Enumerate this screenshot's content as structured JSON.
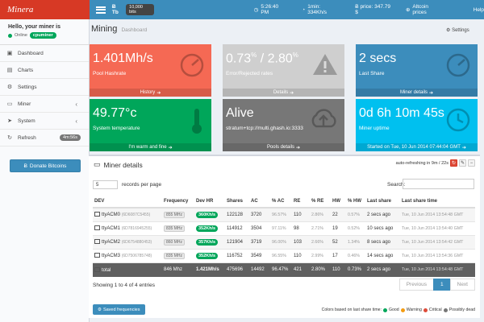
{
  "header": {
    "logo": "Minera",
    "btc_label": "Ƀ Tb",
    "bits_badge": "10,000 bits",
    "time": "5:26:40 PM",
    "hashrate_top": "1min: 334Kh/s",
    "price": "Ƀ price: 347.79 $",
    "altcoin": "Altcoin prices",
    "help": "Help",
    "help_count": "1"
  },
  "user": {
    "hello": "Hello, your miner is",
    "status": "Online",
    "name": "cpuminer"
  },
  "menu": [
    {
      "label": "Dashboard",
      "icon": "dashboard-icon",
      "glyph": "▣",
      "chevron": ""
    },
    {
      "label": "Charts",
      "icon": "charts-icon",
      "glyph": "▤",
      "chevron": ""
    },
    {
      "label": "Settings",
      "icon": "settings-icon",
      "glyph": "⚙",
      "chevron": ""
    },
    {
      "label": "Miner",
      "icon": "desktop-icon",
      "glyph": "▭",
      "chevron": "‹"
    },
    {
      "label": "System",
      "icon": "rocket-icon",
      "glyph": "➤",
      "chevron": "‹"
    },
    {
      "label": "Refresh",
      "icon": "refresh-icon",
      "glyph": "↻",
      "chevron": ""
    }
  ],
  "refresh_badge": "4m:56s",
  "donate": "Donate Bitcoins",
  "page": {
    "title": "Mining",
    "subtitle": "Dashboard",
    "settings": "Settings"
  },
  "boxes": [
    {
      "value": "1.401Mh/s",
      "label": "Pool Hashrate",
      "footer": "History",
      "color": "#f56954",
      "icon": "gauge-icon"
    },
    {
      "value_a": "0.73",
      "sup_a": "%",
      "sep": " / ",
      "value_b": "2.80",
      "sup_b": "%",
      "label": "Error/Rejected rates",
      "footer": "Details",
      "color": "#cfcfcf",
      "icon": "warning-icon"
    },
    {
      "value": "2 secs",
      "label": "Last Share",
      "footer": "Miner details",
      "color": "#3c8dbc",
      "icon": "gauge-icon"
    },
    {
      "value": "49.77°c",
      "label": "System temperature",
      "footer": "I'm warm and fine",
      "color": "#00a65a",
      "icon": "thermometer-icon"
    },
    {
      "value": "Alive",
      "label": "stratum+tcp://multi.ghash.io:3333",
      "footer": "Pools details",
      "color": "#777777",
      "icon": "cloud-upload-icon"
    },
    {
      "value": "0d 6h 10m 45s",
      "label": "Miner uptime",
      "footer": "Started on Tue, 10 Jun 2014 07:44:04 GMT",
      "color": "#00c0ef",
      "icon": "clock-icon"
    }
  ],
  "panel": {
    "title": "Miner details",
    "auto_refresh": "auto-refreshing in 9m / 22s",
    "per_page_value": "5",
    "per_page_label": "records per page",
    "search_label": "Search:",
    "showing": "Showing 1 to 4 of 4 entries",
    "prev": "Previous",
    "page": "1",
    "next": "Next",
    "saved_btn": "Saved frequencies",
    "legend_prefix": "Colors based on last share time:",
    "legend": [
      {
        "label": "Good",
        "color": "#00a65a"
      },
      {
        "label": "Warning",
        "color": "#f39c12"
      },
      {
        "label": "Critical",
        "color": "#dd4b39"
      },
      {
        "label": "Possibly dead",
        "color": "#777777"
      }
    ]
  },
  "table": {
    "headers": [
      "DEV",
      "Frequency",
      "Dev HR",
      "Shares",
      "AC",
      "% AC",
      "RE",
      "% RE",
      "HW",
      "% HW",
      "Last share",
      "Last share time"
    ],
    "rows": [
      {
        "dev": "ttyACM0",
        "serial": "(6D6087C5455)",
        "freq": "855 MHz",
        "hr": "360Kh/s",
        "shares": "122128",
        "ac": "3720",
        "pac": "96.57%",
        "re": "110",
        "pre": "2.86%",
        "hw": "22",
        "phw": "0.57%",
        "last": "2 secs ago",
        "time": "Tue, 10 Jun 2014 13:54:48 GMT"
      },
      {
        "dev": "ttyACM1",
        "serial": "(6D7816945255)",
        "freq": "835 MHz",
        "hr": "352Kh/s",
        "shares": "114912",
        "ac": "3504",
        "pac": "97.11%",
        "re": "98",
        "pre": "2.71%",
        "hw": "19",
        "phw": "0.52%",
        "last": "10 secs ago",
        "time": "Tue, 10 Jun 2014 13:54:40 GMT"
      },
      {
        "dev": "ttyACM2",
        "serial": "(6D6754880453)",
        "freq": "860 MHz",
        "hr": "357Kh/s",
        "shares": "121904",
        "ac": "3719",
        "pac": "96.00%",
        "re": "103",
        "pre": "2.66%",
        "hw": "52",
        "phw": "1.34%",
        "last": "8 secs ago",
        "time": "Tue, 10 Jun 2014 13:54:42 GMT"
      },
      {
        "dev": "ttyACM3",
        "serial": "(6D7506785748)",
        "freq": "835 MHz",
        "hr": "352Kh/s",
        "shares": "116752",
        "ac": "3549",
        "pac": "96.55%",
        "re": "110",
        "pre": "2.99%",
        "hw": "17",
        "phw": "0.46%",
        "last": "14 secs ago",
        "time": "Tue, 10 Jun 2014 13:54:36 GMT"
      }
    ],
    "total": {
      "dev": "total",
      "freq": "846 Mhz",
      "hr": "1.421Mh/s",
      "shares": "475696",
      "ac": "14492",
      "pac": "96.47%",
      "re": "421",
      "pre": "2.80%",
      "hw": "110",
      "phw": "0.73%",
      "last": "2 secs ago",
      "time": "Tue, 10 Jun 2014 13:54:48 GMT"
    }
  }
}
